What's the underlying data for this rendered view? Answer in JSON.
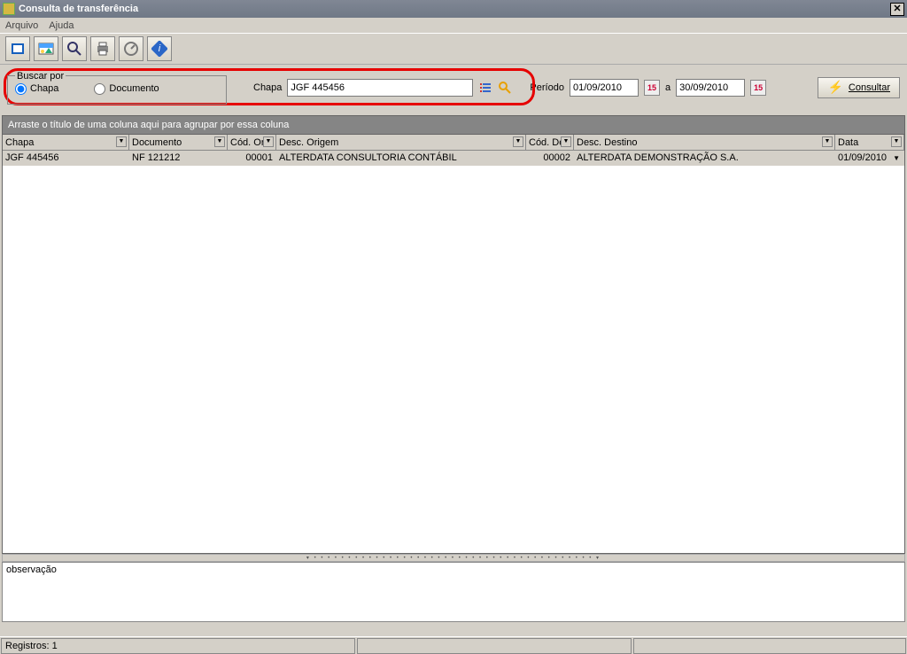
{
  "window": {
    "title": "Consulta de transferência"
  },
  "menu": {
    "arquivo": "Arquivo",
    "ajuda": "Ajuda"
  },
  "search": {
    "fieldset_label": "Buscar por",
    "radio_chapa": "Chapa",
    "radio_documento": "Documento",
    "chapa_label": "Chapa",
    "chapa_value": "JGF 445456",
    "periodo_label": "Período",
    "date_from": "01/09/2010",
    "date_sep": "a",
    "date_to": "30/09/2010",
    "consultar_label": "Consultar"
  },
  "grid": {
    "group_hint": "Arraste o título de uma coluna aqui para agrupar por essa coluna",
    "columns": {
      "chapa": "Chapa",
      "documento": "Documento",
      "cod_or": "Cód. Or",
      "desc_origem": "Desc. Origem",
      "cod_de": "Cód. De",
      "desc_destino": "Desc. Destino",
      "data": "Data"
    },
    "rows": [
      {
        "chapa": "JGF 445456",
        "documento": "NF 121212",
        "cod_or": "00001",
        "desc_origem": "ALTERDATA CONSULTORIA CONTÁBIL",
        "cod_de": "00002",
        "desc_destino": "ALTERDATA DEMONSTRAÇÃO S.A.",
        "data": "01/09/2010"
      }
    ]
  },
  "obs": {
    "label": "observação"
  },
  "status": {
    "registros": "Registros: 1"
  }
}
